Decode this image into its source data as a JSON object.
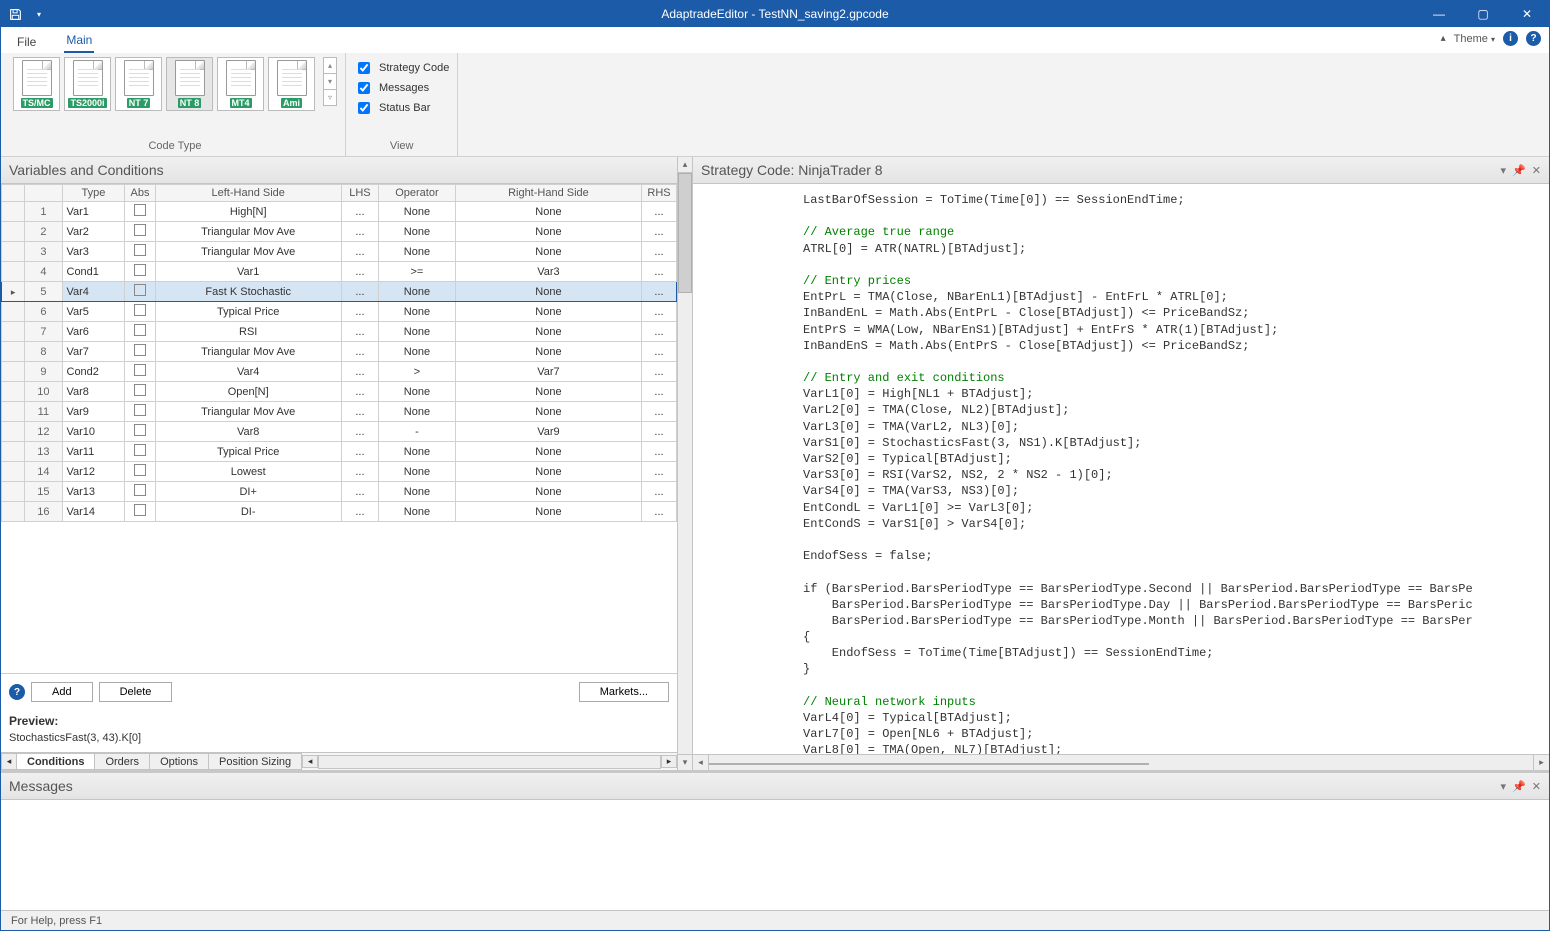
{
  "title": "AdaptradeEditor - TestNN_saving2.gpcode",
  "menu": {
    "file": "File",
    "main": "Main",
    "theme": "Theme"
  },
  "ribbon": {
    "code_type_label": "Code Type",
    "view_label": "View",
    "platforms": [
      "TS/MC",
      "TS2000i",
      "NT 7",
      "NT 8",
      "MT4",
      "Ami"
    ],
    "checks": {
      "strategy_code": "Strategy Code",
      "messages": "Messages",
      "status_bar": "Status Bar"
    }
  },
  "left": {
    "title": "Variables and Conditions",
    "columns": {
      "type": "Type",
      "abs": "Abs",
      "lhs": "Left-Hand Side",
      "l": "LHS",
      "op": "Operator",
      "rhs": "Right-Hand Side",
      "r": "RHS"
    },
    "rows": [
      {
        "n": "1",
        "type": "Var1",
        "lhs": "High[N]",
        "op": "None",
        "rhs": "None"
      },
      {
        "n": "2",
        "type": "Var2",
        "lhs": "Triangular Mov Ave",
        "op": "None",
        "rhs": "None"
      },
      {
        "n": "3",
        "type": "Var3",
        "lhs": "Triangular Mov Ave",
        "op": "None",
        "rhs": "None"
      },
      {
        "n": "4",
        "type": "Cond1",
        "lhs": "Var1",
        "op": ">=",
        "rhs": "Var3"
      },
      {
        "n": "5",
        "type": "Var4",
        "lhs": "Fast K Stochastic",
        "op": "None",
        "rhs": "None",
        "sel": true
      },
      {
        "n": "6",
        "type": "Var5",
        "lhs": "Typical Price",
        "op": "None",
        "rhs": "None"
      },
      {
        "n": "7",
        "type": "Var6",
        "lhs": "RSI",
        "op": "None",
        "rhs": "None"
      },
      {
        "n": "8",
        "type": "Var7",
        "lhs": "Triangular Mov Ave",
        "op": "None",
        "rhs": "None"
      },
      {
        "n": "9",
        "type": "Cond2",
        "lhs": "Var4",
        "op": ">",
        "rhs": "Var7"
      },
      {
        "n": "10",
        "type": "Var8",
        "lhs": "Open[N]",
        "op": "None",
        "rhs": "None"
      },
      {
        "n": "11",
        "type": "Var9",
        "lhs": "Triangular Mov Ave",
        "op": "None",
        "rhs": "None"
      },
      {
        "n": "12",
        "type": "Var10",
        "lhs": "Var8",
        "op": "-",
        "rhs": "Var9"
      },
      {
        "n": "13",
        "type": "Var11",
        "lhs": "Typical Price",
        "op": "None",
        "rhs": "None"
      },
      {
        "n": "14",
        "type": "Var12",
        "lhs": "Lowest",
        "op": "None",
        "rhs": "None"
      },
      {
        "n": "15",
        "type": "Var13",
        "lhs": "DI+",
        "op": "None",
        "rhs": "None"
      },
      {
        "n": "16",
        "type": "Var14",
        "lhs": "DI-",
        "op": "None",
        "rhs": "None"
      }
    ],
    "buttons": {
      "add": "Add",
      "delete": "Delete",
      "markets": "Markets..."
    },
    "preview_label": "Preview:",
    "preview_value": "StochasticsFast(3, 43).K[0]",
    "tabs": {
      "conditions": "Conditions",
      "orders": "Orders",
      "options": "Options",
      "sizing": "Position Sizing"
    }
  },
  "right": {
    "title": "Strategy Code: NinjaTrader 8"
  },
  "messages": {
    "title": "Messages"
  },
  "status": {
    "text": "For Help, press F1"
  }
}
